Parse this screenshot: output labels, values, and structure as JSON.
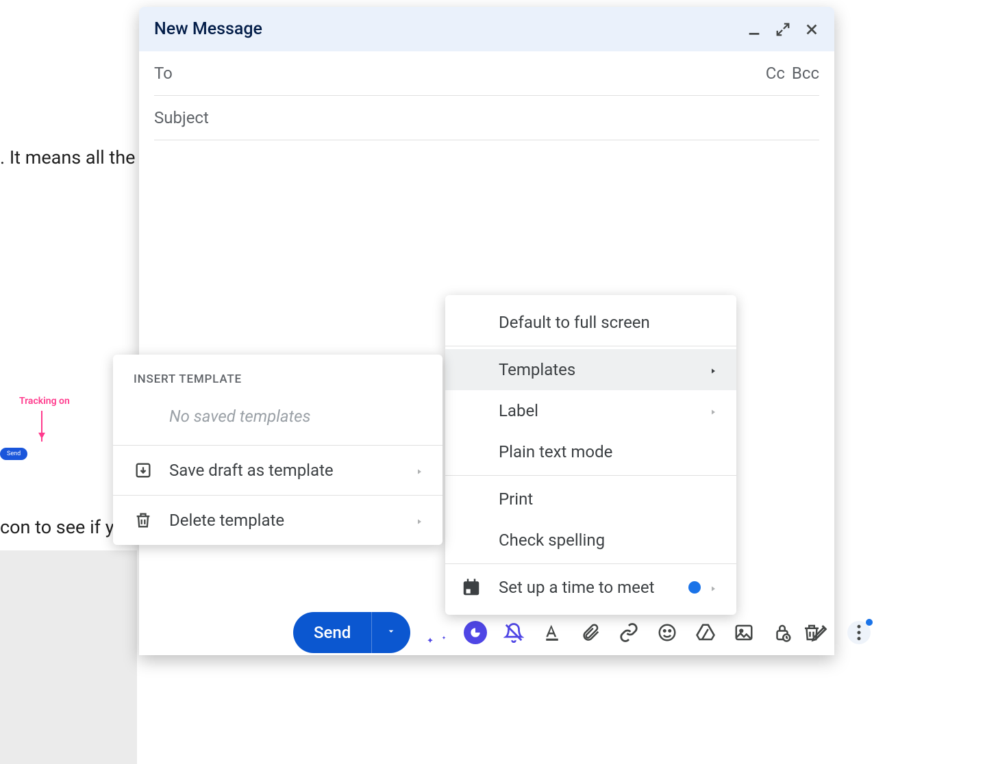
{
  "bg": {
    "line1": ". It means all the new",
    "line2": "con to see if your",
    "tracking_label": "Tracking on",
    "mini_send": "Send"
  },
  "compose": {
    "title": "New Message",
    "to_label": "To",
    "cc_label": "Cc",
    "bcc_label": "Bcc",
    "subject_placeholder": "Subject",
    "send_label": "Send"
  },
  "more_menu": {
    "default_full_screen": "Default to full screen",
    "templates": "Templates",
    "label": "Label",
    "plain_text": "Plain text mode",
    "print": "Print",
    "check_spelling": "Check spelling",
    "set_up_meeting": "Set up a time to meet"
  },
  "templates_menu": {
    "header": "INSERT TEMPLATE",
    "empty": "No saved templates",
    "save_draft": "Save draft as template",
    "delete": "Delete template"
  }
}
